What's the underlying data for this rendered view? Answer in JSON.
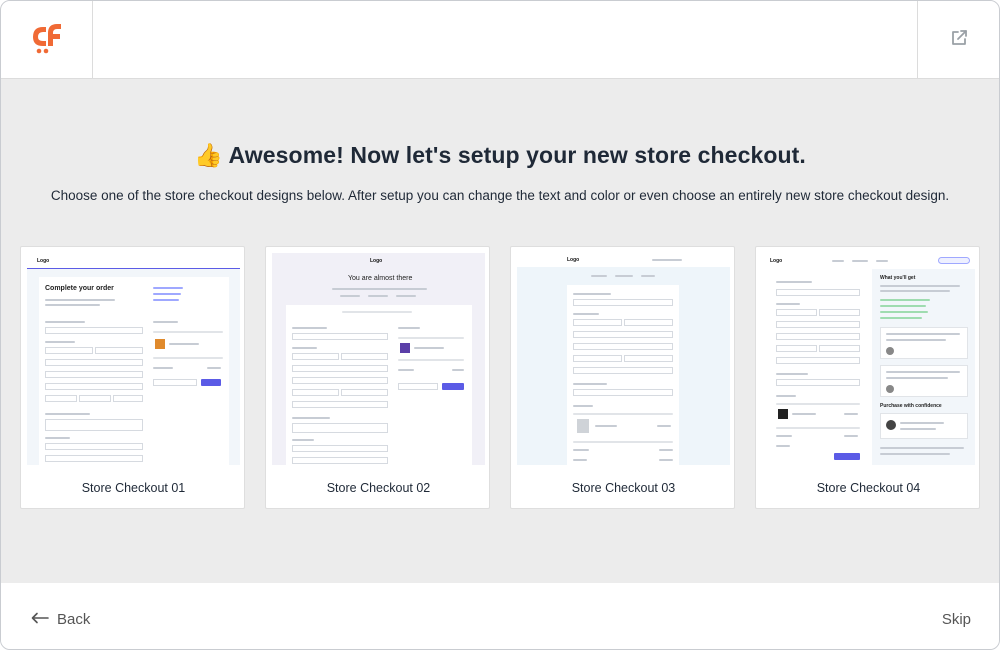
{
  "header": {
    "logo_icon": "cartflows-logo-icon",
    "external_icon": "external-link-icon"
  },
  "heading": {
    "emoji": "👍",
    "title": "Awesome! Now let's setup your new store checkout."
  },
  "subheading": "Choose one of the store checkout designs below. After setup you can change the text and color or even choose an entirely new store checkout design.",
  "templates": [
    {
      "name": "Store Checkout 01"
    },
    {
      "name": "Store Checkout 02"
    },
    {
      "name": "Store Checkout 03"
    },
    {
      "name": "Store Checkout 04"
    }
  ],
  "preview_text": {
    "logo": "Logo",
    "t1_title": "Complete your order",
    "t2_title": "You are almost there",
    "t4_side": "What you'll get",
    "t4_side2": "Purchase with confidence"
  },
  "footer": {
    "back_label": "Back",
    "skip_label": "Skip",
    "back_icon": "arrow-left-icon"
  },
  "colors": {
    "brand": "#f06a35",
    "accent": "#5b5be6",
    "background": "#ececec"
  }
}
